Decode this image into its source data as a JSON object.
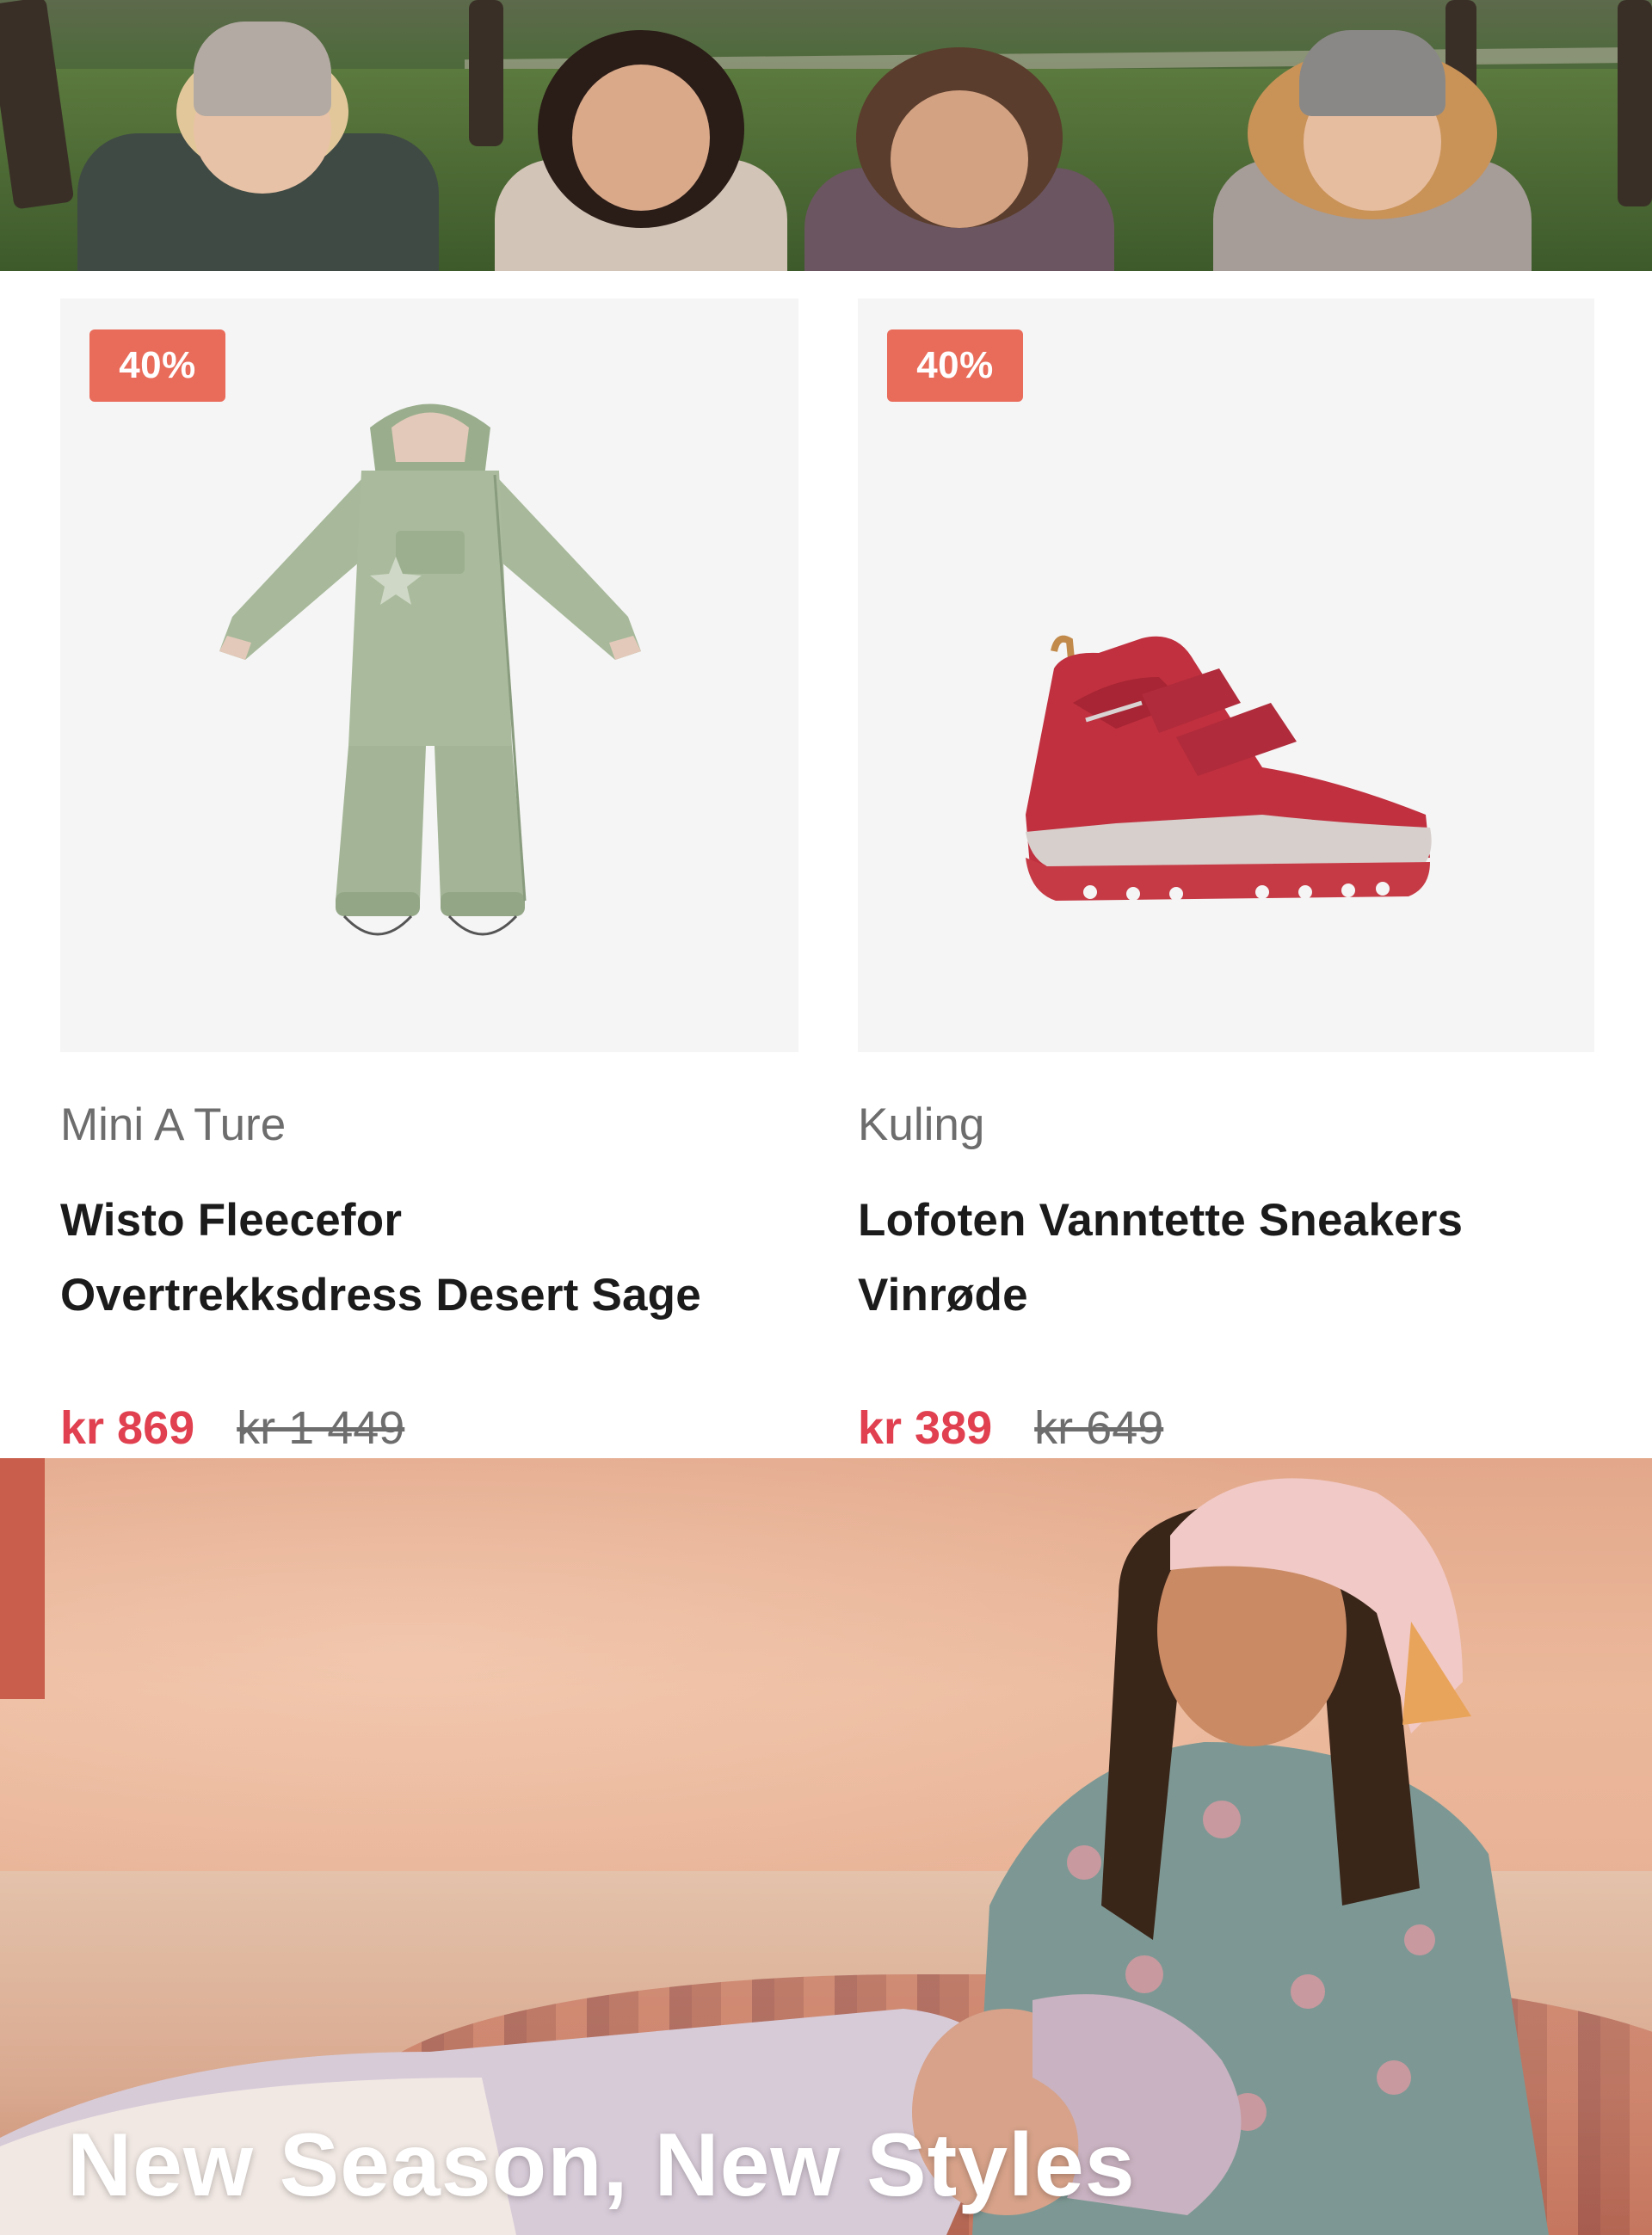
{
  "products": [
    {
      "discount": "40%",
      "brand": "Mini A Ture",
      "title_line1": "Wisto Fleecefor",
      "title_line2": "Overtrekksdress Desert Sage",
      "price_now": "kr 869",
      "price_old": "kr 1 449"
    },
    {
      "discount": "40%",
      "brand": "Kuling",
      "title_line1": "Lofoten Vanntette Sneakers",
      "title_line2": "Vinrøde",
      "price_now": "kr 389",
      "price_old": "kr 649"
    }
  ],
  "banner": {
    "title": "New Season, New Styles"
  },
  "colors": {
    "badge": "#e96b5a",
    "price_now": "#e0404f",
    "card_bg": "#f5f5f5"
  }
}
